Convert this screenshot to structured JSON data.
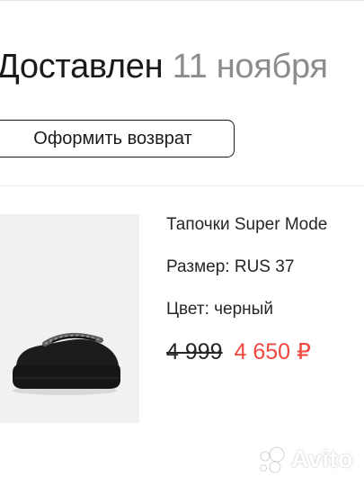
{
  "order": {
    "status_title": "Доставлен",
    "status_date": "11 ноября"
  },
  "actions": {
    "return_label": "Оформить возврат"
  },
  "product": {
    "name": "Тапочки Super Mode",
    "size_line": "Размер: RUS 37",
    "color_line": "Цвет: черный",
    "old_price": "4 999",
    "new_price": "4 650 ₽",
    "image_icon": "black-platform-slipper"
  },
  "watermark": {
    "text": "Avito",
    "icon": "avito-logo-icon"
  },
  "colors": {
    "text": "#1a1a1a",
    "muted": "#8c8c8c",
    "sale": "#f0483e",
    "image_bg": "#f1f1f1"
  }
}
